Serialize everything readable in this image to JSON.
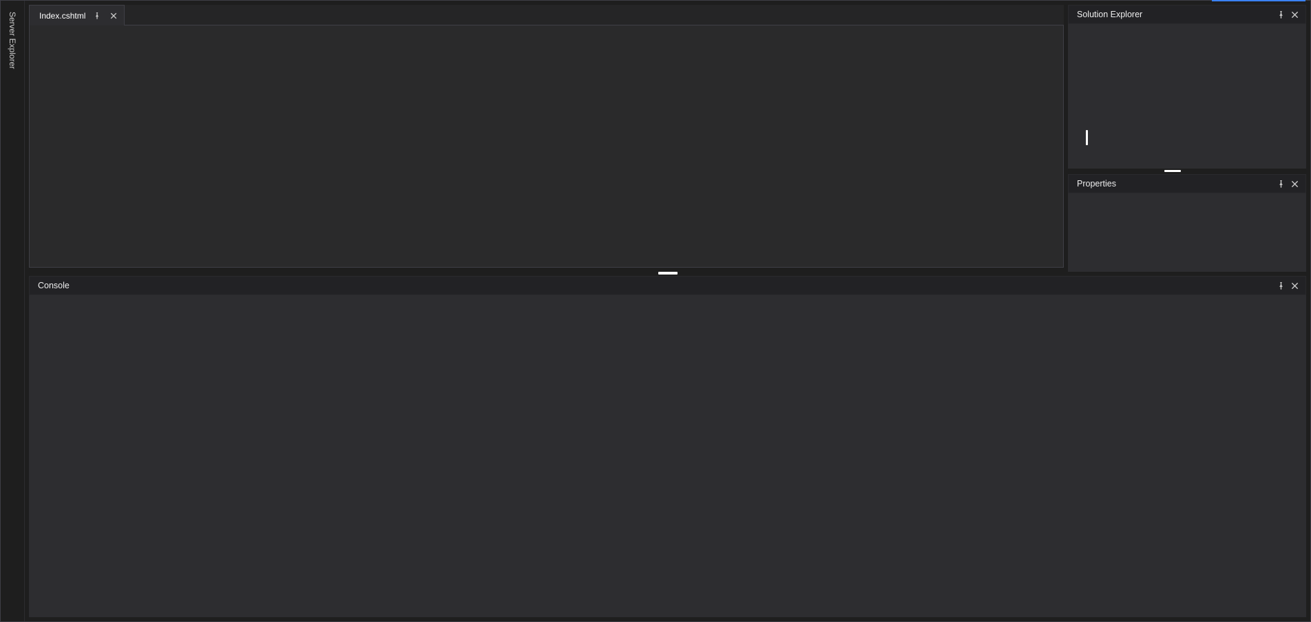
{
  "leftSidebar": {
    "serverExplorer": {
      "label": "Server Explorer"
    }
  },
  "editor": {
    "tabs": [
      {
        "label": "Index.cshtml"
      }
    ]
  },
  "rightDock": {
    "panels": [
      {
        "title": "Solution Explorer"
      },
      {
        "title": "Properties"
      }
    ]
  },
  "bottomDock": {
    "console": {
      "title": "Console"
    }
  },
  "icons": {
    "pin": "pin-icon",
    "close": "close-icon"
  }
}
